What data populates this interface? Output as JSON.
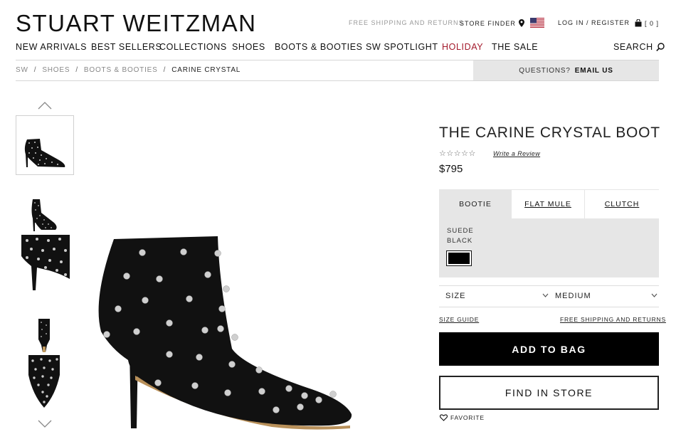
{
  "header": {
    "logo": "STUART WEITZMAN",
    "free_shipping": "FREE SHIPPING AND RETURNS",
    "store_finder": "STORE FINDER",
    "login": "LOG IN / REGISTER",
    "bag_count": "[ 0 ]",
    "flag_icon": "us-flag-icon",
    "bag_icon": "shopping-bag-icon",
    "pin_icon": "map-pin-icon"
  },
  "nav": {
    "items": [
      {
        "label": "NEW ARRIVALS"
      },
      {
        "label": "BEST SELLERS"
      },
      {
        "label": "COLLECTIONS"
      },
      {
        "label": "SHOES"
      },
      {
        "label": "BOOTS & BOOTIES"
      },
      {
        "label": "SW SPOTLIGHT"
      },
      {
        "label": "HOLIDAY"
      },
      {
        "label": "THE SALE"
      }
    ],
    "search": "SEARCH",
    "holiday_color": "#a3192b"
  },
  "breadcrumb": {
    "items": [
      "SW",
      "SHOES",
      "BOOTS & BOOTIES",
      "CARINE CRYSTAL"
    ],
    "separator": "/"
  },
  "questions": {
    "label": "QUESTIONS?",
    "link": "EMAIL US"
  },
  "product": {
    "title": "THE CARINE CRYSTAL BOOT",
    "stars": "☆☆☆☆☆",
    "rating": 0,
    "review_link": "Write a Review",
    "price": "$795",
    "styles": [
      "BOOTIE",
      "FLAT MULE",
      "CLUTCH"
    ],
    "material": "SUEDE",
    "color": "BLACK",
    "size_label": "SIZE",
    "width_value": "MEDIUM",
    "size_guide": "SIZE GUIDE",
    "free_shipping": "FREE SHIPPING AND RETURNS",
    "add_to_bag": "ADD TO BAG",
    "find_in_store": "FIND IN STORE",
    "favorite": "FAVORITE"
  }
}
